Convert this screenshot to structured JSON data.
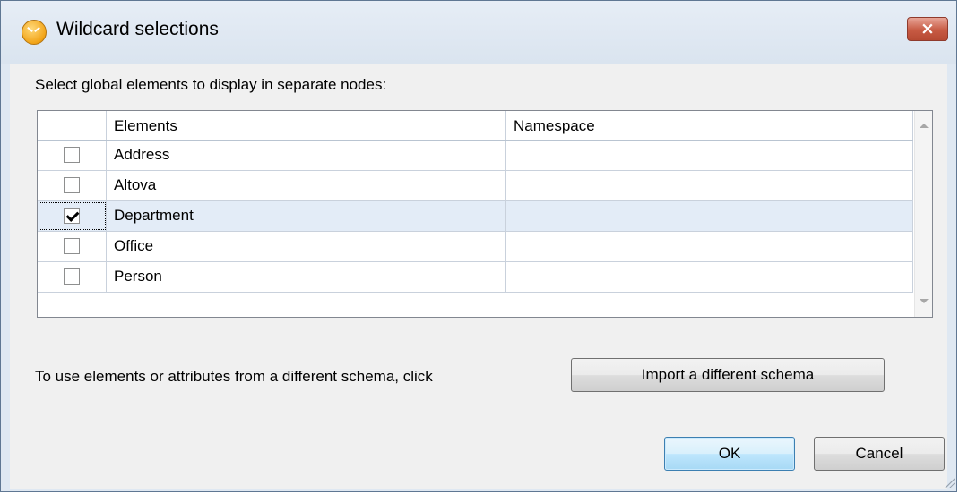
{
  "dialog": {
    "title": "Wildcard selections",
    "close_label": "×"
  },
  "prompt": "Select global elements to display in separate nodes:",
  "grid": {
    "columns": [
      "",
      "Elements",
      "Namespace"
    ],
    "rows": [
      {
        "checked": false,
        "element": "Address",
        "namespace": ""
      },
      {
        "checked": false,
        "element": "Altova",
        "namespace": ""
      },
      {
        "checked": true,
        "element": "Department",
        "namespace": ""
      },
      {
        "checked": false,
        "element": "Office",
        "namespace": ""
      },
      {
        "checked": false,
        "element": "Person",
        "namespace": ""
      }
    ],
    "selected_row": "Department"
  },
  "import": {
    "text": "To use elements or attributes from a different schema, click",
    "button_label": "Import a different schema"
  },
  "buttons": {
    "ok": "OK",
    "cancel": "Cancel"
  },
  "colors": {
    "title_bar": "#dae4ef",
    "close_button": "#c75a43",
    "selected_row": "#e3ecf7",
    "ok_button": "#bee6fd"
  },
  "icons": {
    "app": "altova-mapforce-icon",
    "close": "close-icon",
    "checkbox_checked": "checkmark-icon"
  }
}
